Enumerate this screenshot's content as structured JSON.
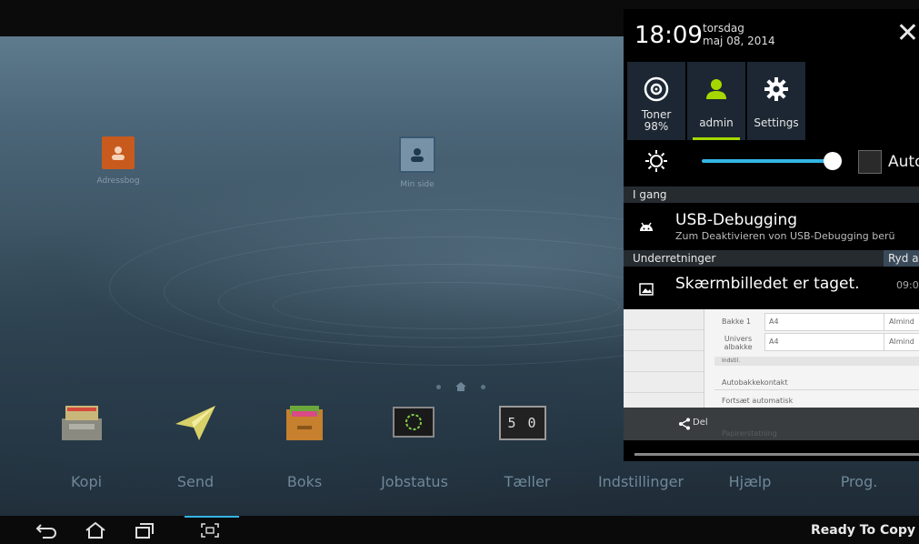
{
  "home": {
    "desktop_icons": [
      {
        "label": "Adressbog",
        "icon": "contacts-icon"
      },
      {
        "label": "Min side",
        "icon": "profile-icon"
      }
    ],
    "dock": [
      {
        "label": "Kopi",
        "icon": "copy-icon"
      },
      {
        "label": "Send",
        "icon": "send-icon"
      },
      {
        "label": "Boks",
        "icon": "box-icon"
      },
      {
        "label": "Jobstatus",
        "icon": "job-status-icon"
      },
      {
        "label": "Tæller",
        "icon": "counter-icon"
      },
      {
        "label": "Indstillinger",
        "icon": "settings-icon"
      },
      {
        "label": "Hjælp",
        "icon": "help-icon"
      },
      {
        "label": "Prog.",
        "icon": "program-icon"
      }
    ],
    "counter_digits": "5 0"
  },
  "navbar": {
    "buttons": [
      "back-icon",
      "home-icon",
      "recent-apps-icon",
      "screenshot-icon"
    ],
    "status": "Ready To Copy"
  },
  "panel": {
    "time": "18:09",
    "day": "torsdag",
    "date": "maj 08, 2014",
    "close": "✕",
    "quick_settings": [
      {
        "label": "Toner",
        "sublabel": "98%",
        "icon": "toner-icon"
      },
      {
        "label": "admin",
        "icon": "user-icon",
        "active": true
      },
      {
        "label": "Settings",
        "icon": "gear-icon"
      }
    ],
    "brightness": {
      "auto_label": "Auto",
      "level": 0.85
    },
    "ongoing_header": "I gang",
    "ongoing": {
      "title": "USB-Debugging",
      "subtitle": "Zum Deaktivieren von USB-Debugging berü"
    },
    "notifications_header": "Underretninger",
    "clear_label": "Ryd a",
    "screenshot_notif": {
      "title": "Skærmbilledet er taget.",
      "time": "09:0"
    },
    "preview": {
      "rows": [
        {
          "label": "Bakke 1",
          "value": "A4",
          "right": "Almind"
        },
        {
          "label": "Univers albakke",
          "value": "A4",
          "right": "Almind"
        }
      ],
      "section": "Indstil.",
      "lines": [
        "Autobakkekontakt",
        "Fortsæt automatisk",
        "Papirerstatning"
      ]
    },
    "share_label": "Del"
  },
  "colors": {
    "accent_green": "#a6d800",
    "slider_blue": "#33b5e5"
  }
}
